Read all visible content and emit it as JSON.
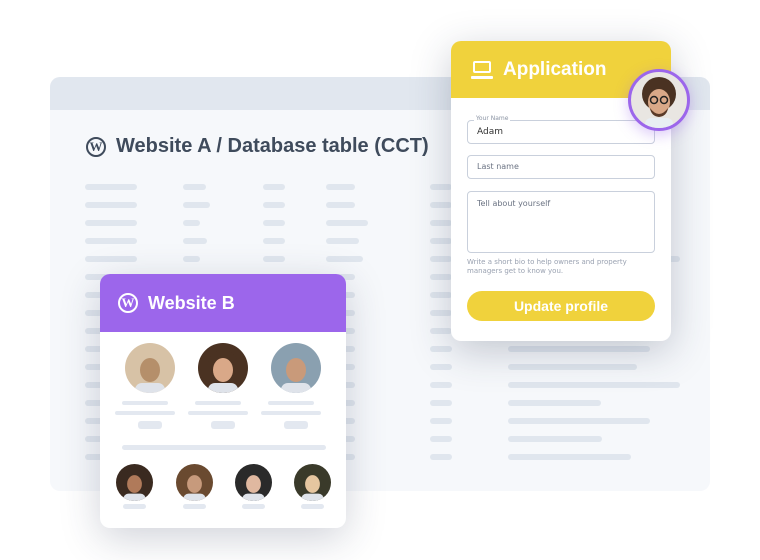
{
  "website_a": {
    "title": "Website A / Database table (CCT)",
    "icon": "wordpress-icon"
  },
  "website_b": {
    "title": "Website B",
    "icon": "wordpress-icon",
    "top_profiles": [
      {
        "name": "profile-woman-blonde"
      },
      {
        "name": "profile-man-curly-glasses"
      },
      {
        "name": "profile-man-beard"
      }
    ],
    "bottom_profiles": [
      {
        "name": "profile-man-glasses"
      },
      {
        "name": "profile-woman-glasses"
      },
      {
        "name": "profile-person-hat"
      },
      {
        "name": "profile-woman-smiling"
      }
    ]
  },
  "application": {
    "title": "Application",
    "icon": "laptop-icon",
    "first_name_label": "Your Name",
    "first_name_value": "Adam",
    "last_name_placeholder": "Last name",
    "bio_placeholder": "Tell about yourself",
    "bio_helper": "Write a short bio to help owners and property managers get to know you.",
    "submit_label": "Update profile"
  },
  "colors": {
    "purple": "#9c66eb",
    "yellow": "#f0d23c",
    "skeleton": "#e0e6ee"
  }
}
